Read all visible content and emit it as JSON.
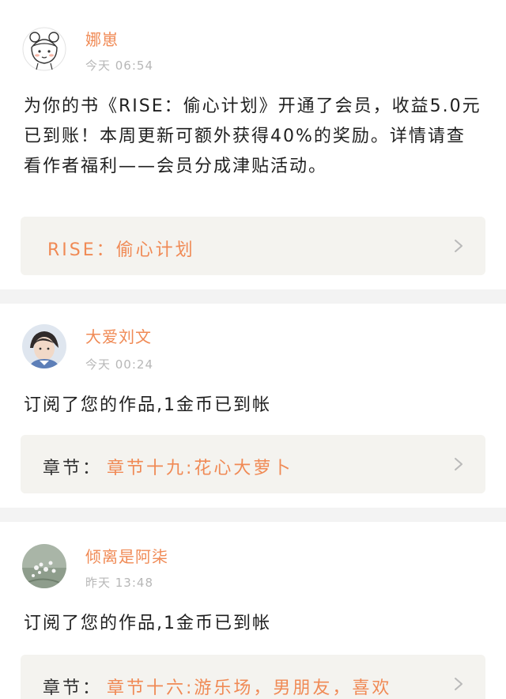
{
  "notifications": [
    {
      "name": "娜崽",
      "time": "今天 06:54",
      "message": "为你的书《RISE：偷心计划》开通了会员，收益5.0元已到账！本周更新可额外获得40%的奖励。详情请查看作者福利——会员分成津贴活动。",
      "link_prefix": "",
      "link_text": "RISE：偷心计划",
      "avatar_icon": "bear-girl-avatar-icon"
    },
    {
      "name": "大爱刘文",
      "time": "今天 00:24",
      "message": "订阅了您的作品,1金币已到帐",
      "link_prefix": "章节：",
      "link_text": "章节十九:花心大萝卜",
      "avatar_icon": "photo-avatar-icon"
    },
    {
      "name": "倾离是阿柒",
      "time": "昨天 13:48",
      "message": "订阅了您的作品,1金币已到帐",
      "link_prefix": "章节：",
      "link_text": "章节十六:游乐场，男朋友，喜欢",
      "avatar_icon": "flowers-avatar-icon"
    }
  ],
  "colors": {
    "accent": "#f08a55",
    "link_bg": "#f4f3ef",
    "divider": "#f3f3f3"
  }
}
